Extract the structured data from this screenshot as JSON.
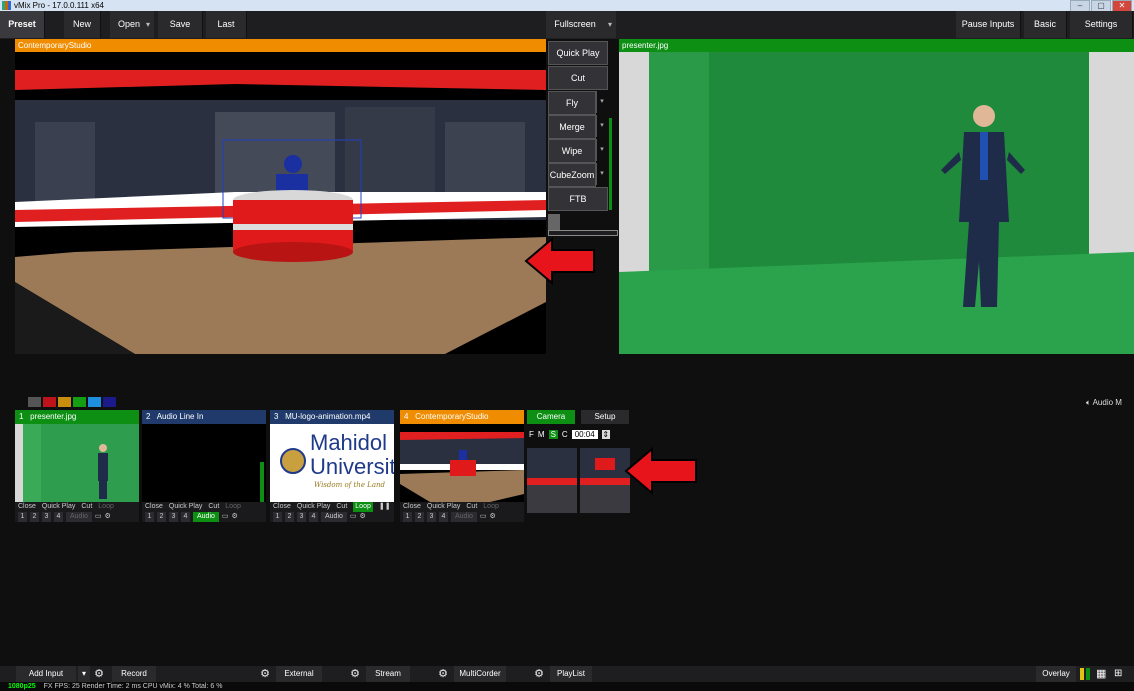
{
  "window": {
    "title": "vMix Pro - 17.0.0.111 x64",
    "controls": [
      "–",
      "▢",
      "✕"
    ]
  },
  "toolbar": {
    "preset": "Preset",
    "new": "New",
    "open": "Open",
    "save": "Save",
    "last": "Last",
    "fullscreen": "Fullscreen",
    "pause_inputs": "Pause Inputs",
    "basic": "Basic",
    "settings": "Settings"
  },
  "preview": {
    "title": "ContemporaryStudio",
    "header_color": "#f08c00"
  },
  "output": {
    "title": "presenter.jpg",
    "header_color": "#0c8f13"
  },
  "transitions": [
    "Quick Play",
    "Cut",
    "Fly",
    "Merge",
    "Wipe",
    "CubeZoom",
    "FTB"
  ],
  "audio_mixer": {
    "label": "Audio M"
  },
  "color_swatches": [
    "#555555",
    "#c0121a",
    "#c98d10",
    "#149e14",
    "#7a22a0",
    "#1e8fe0",
    "#1a1a8a"
  ],
  "inputs": [
    {
      "number": "1",
      "name": "presenter.jpg",
      "header_color": "#0c8f13",
      "controls": [
        "Close",
        "Quick Play",
        "Cut",
        "Loop"
      ],
      "audio": "Audio",
      "audio_on": false,
      "numbers": [
        "1",
        "2",
        "3",
        "4"
      ]
    },
    {
      "number": "2",
      "name": "Audio Line In",
      "header_color": "#1f3a6b",
      "controls": [
        "Close",
        "Quick Play",
        "Cut",
        "Loop"
      ],
      "audio": "Audio",
      "audio_on": true,
      "numbers": [
        "1",
        "2",
        "3",
        "4"
      ]
    },
    {
      "number": "3",
      "name": "MU-logo-animation.mp4",
      "header_color": "#1f3a6b",
      "controls": [
        "Close",
        "Quick Play",
        "Cut",
        "Loop"
      ],
      "audio": "Audio",
      "audio_on": false,
      "numbers": [
        "1",
        "2",
        "3",
        "4"
      ],
      "logo_text": "Mahidol",
      "logo_text2": "Universit",
      "logo_tagline": "Wisdom of the Land"
    },
    {
      "number": "4",
      "name": "ContemporaryStudio",
      "header_color": "#f08c00",
      "controls": [
        "Close",
        "Quick Play",
        "Cut",
        "Loop"
      ],
      "audio": "Audio",
      "audio_on": false,
      "numbers": [
        "1",
        "2",
        "3",
        "4"
      ]
    }
  ],
  "camera_panel": {
    "camera_tab": "Camera",
    "setup_tab": "Setup",
    "modes": [
      "F",
      "M",
      "S",
      "C"
    ],
    "time_value": "00:04"
  },
  "bottom": {
    "add_input": "Add Input",
    "record": "Record",
    "external": "External",
    "stream": "Stream",
    "multicorder": "MultiCorder",
    "playlist": "PlayList",
    "overlay": "Overlay"
  },
  "status": {
    "resolution": "1080p25",
    "text": "FX  FPS: 25  Render Time: 2 ms  CPU vMix: 4 %  Total: 6 %"
  },
  "annotation_color": "#e8141b"
}
